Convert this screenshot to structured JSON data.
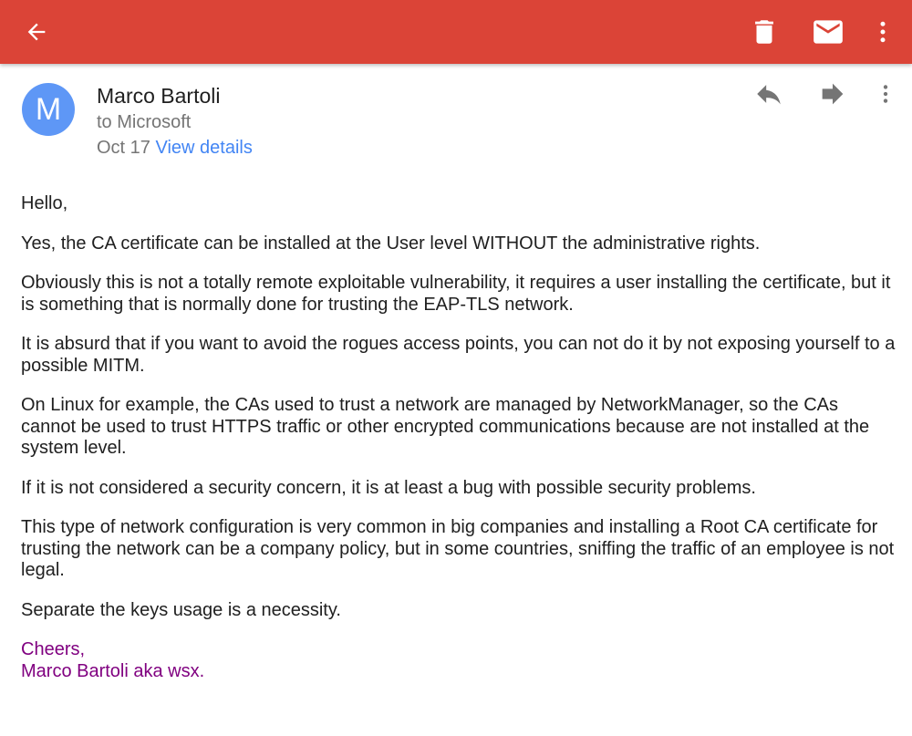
{
  "toolbar": {
    "back_icon": "arrow-back-icon",
    "delete_icon": "trash-icon",
    "mail_icon": "mail-icon",
    "overflow_icon": "more-vert-icon",
    "background_color": "#db4437"
  },
  "message": {
    "avatar_letter": "M",
    "avatar_color": "#5e97f6",
    "sender": "Marco Bartoli",
    "recipient": "to Microsoft",
    "date": "Oct 17",
    "view_details": "View details",
    "actions": [
      "reply-icon",
      "forward-icon",
      "more-vert-icon"
    ]
  },
  "body": {
    "paragraphs": [
      "Hello,",
      "Yes, the CA certificate can be installed at the User level WITHOUT the administrative rights.",
      "Obviously this is not a totally remote exploitable vulnerability, it requires a user installing the certificate, but it is something that is normally done for trusting the EAP-TLS network.",
      "It is absurd that if you want to avoid the rogues access points, you can not do it by not exposing yourself to a possible MITM.",
      "On Linux for example, the CAs used to trust a network are managed by NetworkManager, so the CAs cannot be used to trust HTTPS traffic or other encrypted communications because are not installed at the system level.",
      "If it is not considered a security concern, it is at least a bug with possible security problems.",
      "This type of network configuration is very common in big companies and installing a Root CA certificate for trusting the network can be a company policy, but in some countries, sniffing the traffic of an employee is not legal.",
      "Separate the keys usage is a necessity."
    ],
    "signature_line1": "Cheers,",
    "signature_line2": "Marco Bartoli aka wsx.",
    "signature_color": "#800080"
  }
}
